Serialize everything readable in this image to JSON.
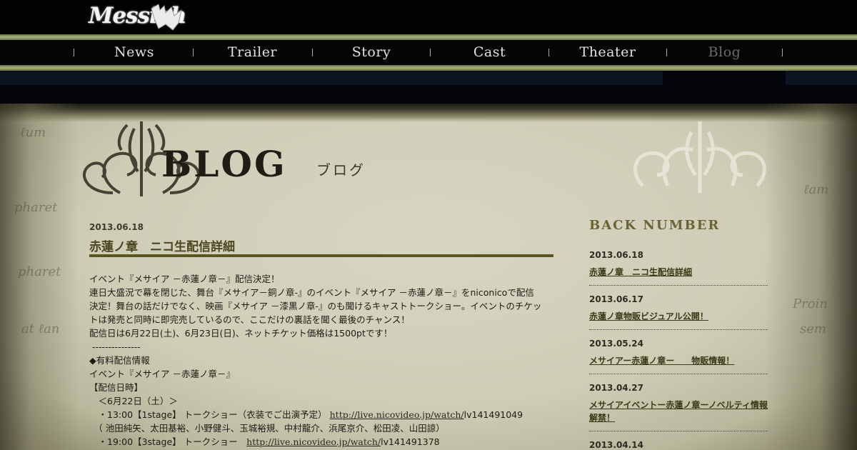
{
  "header": {
    "logo_text": "Messiah",
    "nav": [
      {
        "label": "News",
        "active": false
      },
      {
        "label": "Trailer",
        "active": false
      },
      {
        "label": "Story",
        "active": false
      },
      {
        "label": "Cast",
        "active": false
      },
      {
        "label": "Theater",
        "active": false
      },
      {
        "label": "Blog",
        "active": true
      }
    ]
  },
  "page": {
    "title": "BLOG",
    "subtitle": "ブログ"
  },
  "post": {
    "date": "2013.06.18",
    "title": "赤蓮ノ章　ニコ生配信詳細",
    "lines": [
      "イベント『メサイア －赤蓮ノ章－』配信決定！",
      "連日大盛況で幕を閉じた、舞台『メサイア－銅ノ章-』のイベント『メサイア －赤蓮ノ章－』をniconicoで配信",
      "決定！舞台の話だけでなく、映画『メサイア －漆黒ノ章-』のも聞けるキャストトークショー。イベントのチケッ",
      "トは発売と同時に即完売しているので、ここだけの裏話を聞く最後のチャンス！",
      "配信日は6月22日(土)、6月23日(日)、ネットチケット価格は1500ptです！",
      " ---------------",
      "◆有料配信情報",
      "イベント『メサイア －赤蓮ノ章－』",
      "【配信日時】",
      "　＜6月22日（土）＞"
    ],
    "stage1_prefix": "　・13:00【1stage】 トークショー（衣装でご出演予定） ",
    "stage1_link": "http://live.nicovideo.jp/watch/",
    "stage1_suffix": "lv141491049",
    "cast_line": "　（ 池田純矢、太田基裕、小野健斗、玉城裕規、中村龍介、浜尾京介、松田凌、山田諒）",
    "stage3_prefix": "　・19:00【3stage】 トークショー　",
    "stage3_link": "http://live.nicovideo.jp/watch/",
    "stage3_suffix": "lv141491378"
  },
  "sidebar": {
    "heading": "BACK NUMBER",
    "entries": [
      {
        "date": "2013.06.18",
        "title": "赤蓮ノ章　ニコ生配信詳細"
      },
      {
        "date": "2013.06.17",
        "title": "赤蓮ノ章物販ビジュアル公開！"
      },
      {
        "date": "2013.05.24",
        "title": "メサイアー赤蓮ノ章ー　　物販情報！"
      },
      {
        "date": "2013.04.27",
        "title": "メサイアイベントー赤蓮ノ章ーノベルティ情報解禁！"
      },
      {
        "date": "2013.04.14",
        "title": ""
      }
    ]
  },
  "colors": {
    "accent": "#5a5620",
    "nav_active": "#6a6a6a",
    "parchment": "#d8d6c2"
  }
}
